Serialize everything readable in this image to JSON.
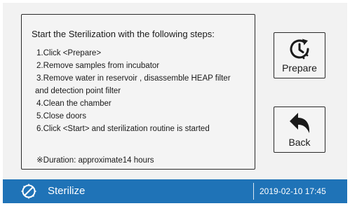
{
  "panel": {
    "title": "Start the Sterilization with the following steps:",
    "steps": [
      "1.Click <Prepare>",
      "2.Remove samples from incubator",
      "3.Remove water in reservoir , disassemble HEAP filter",
      "and detection point filter",
      "4.Clean the chamber",
      "5.Close doors",
      "6.Click <Start> and sterilization routine is started"
    ],
    "duration": "※Duration: approximate14 hours"
  },
  "buttons": {
    "prepare_label": "Prepare",
    "prepare_icon": "clock-refresh-icon",
    "back_label": "Back",
    "back_icon": "back-arrow-icon"
  },
  "statusbar": {
    "title": "Sterilize",
    "icon": "no-germs-icon",
    "datetime": "2019-02-10  17:45",
    "color": "#1f73b7"
  }
}
